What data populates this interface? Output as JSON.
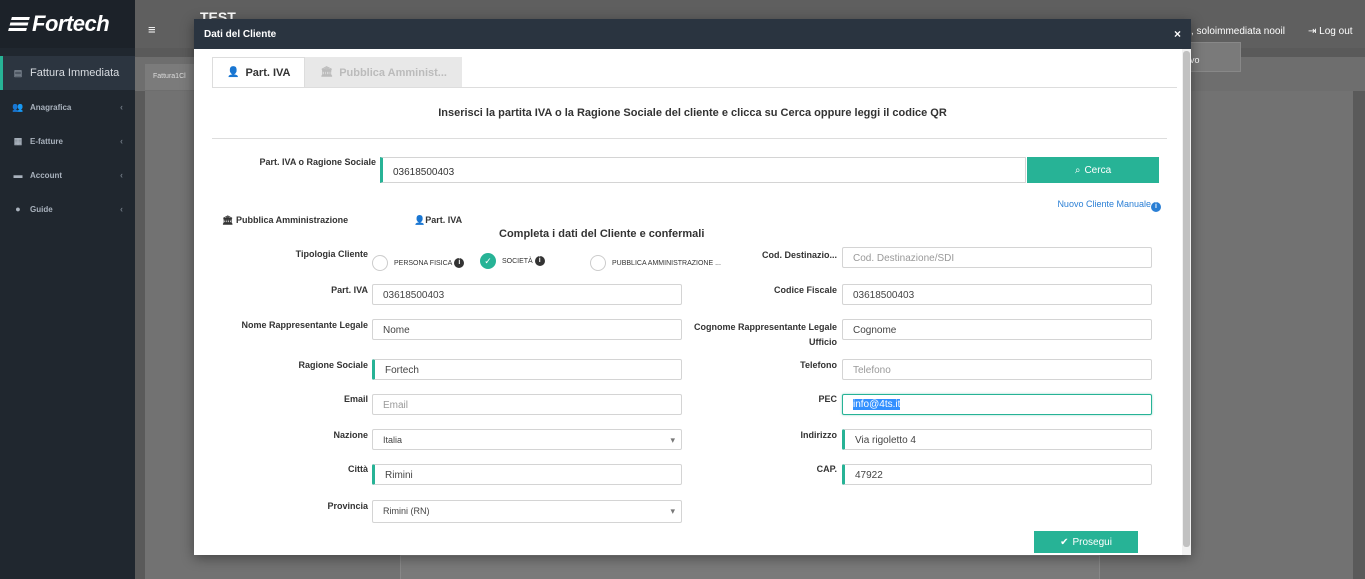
{
  "app": {
    "brand": "Fortech",
    "top_label": "TEST",
    "user_text": ", soloimmediata nooil",
    "logout_label": "Log out",
    "bg_tab": "Fattura1Cl",
    "bg_box_text": "vo"
  },
  "sidebar": {
    "items": [
      {
        "label": "Fattura Immediata",
        "icon": "file-icon"
      },
      {
        "label": "Anagrafica",
        "icon": "users-icon"
      },
      {
        "label": "E-fatture",
        "icon": "table-icon"
      },
      {
        "label": "Account",
        "icon": "folder-icon"
      },
      {
        "label": "Guide",
        "icon": "info-icon"
      }
    ]
  },
  "modal": {
    "title": "Dati del Cliente",
    "close": "×",
    "tabs": [
      {
        "label": "Part. IVA",
        "icon": "user-icon"
      },
      {
        "label": "Pubblica Amminist...",
        "icon": "bank-icon"
      }
    ],
    "instruction": "Inserisci la partita IVA o la Ragione Sociale del cliente e clicca su Cerca oppure leggi il codice QR",
    "search": {
      "label": "Part. IVA o Ragione Sociale",
      "value": "03618500403",
      "button": "Cerca"
    },
    "new_client_link": "Nuovo Cliente Manuale",
    "subtabs": {
      "pa": "Pubblica Amministrazione",
      "piva": "Part. IVA"
    },
    "section_title": "Completa i dati del Cliente e confermali",
    "tipologia": {
      "label": "Tipologia Cliente",
      "options": [
        "PERSONA FISICA",
        "SOCIETÀ",
        "PUBBLICA AMMINISTRAZIONE ..."
      ],
      "selected": "SOCIETÀ"
    },
    "fields": {
      "cod_dest_label": "Cod. Destinazio...",
      "cod_dest_placeholder": "Cod. Destinazione/SDI",
      "piva_label": "Part. IVA",
      "piva_value": "03618500403",
      "cf_label": "Codice Fiscale",
      "cf_value": "03618500403",
      "nome_label": "Nome Rappresentante Legale",
      "nome_value": "Nome",
      "cognome_label_1": "Cognome Rappresentante Legale",
      "cognome_label_2": "Ufficio",
      "cognome_value": "Cognome",
      "ragione_label": "Ragione Sociale",
      "ragione_value": "Fortech",
      "telefono_label": "Telefono",
      "telefono_placeholder": "Telefono",
      "email_label": "Email",
      "email_placeholder": "Email",
      "pec_label": "PEC",
      "pec_value": "info@4ts.it",
      "nazione_label": "Nazione",
      "nazione_value": "Italia",
      "indirizzo_label": "Indirizzo",
      "indirizzo_value": "Via rigoletto 4",
      "citta_label": "Città",
      "citta_value": "Rimini",
      "cap_label": "CAP.",
      "cap_value": "47922",
      "provincia_label": "Provincia",
      "provincia_value": "Rimini (RN)"
    },
    "submit": "Prosegui"
  },
  "colors": {
    "accent": "#27b396",
    "header": "#2a3440",
    "sidebar": "#20272f",
    "link": "#2a7fd5"
  }
}
